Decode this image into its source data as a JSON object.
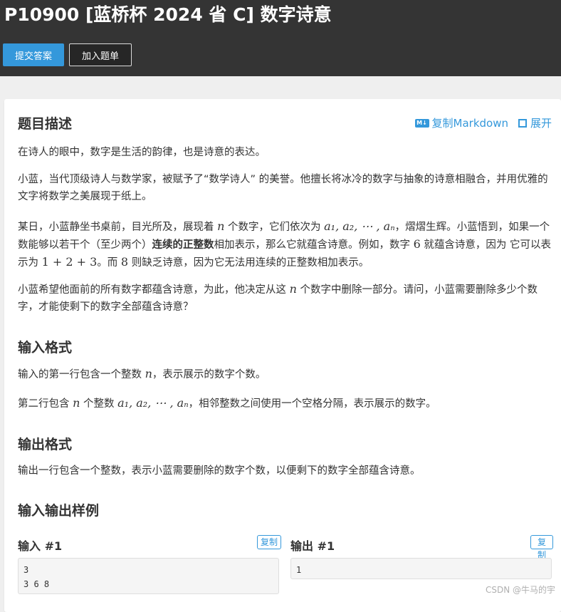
{
  "header": {
    "title": "P10900 [蓝桥杯 2024 省 C] 数字诗意",
    "submit_label": "提交答案",
    "add_list_label": "加入题单"
  },
  "tools": {
    "copy_markdown": "复制Markdown",
    "expand": "展开",
    "md_icon_text": "M↓"
  },
  "description": {
    "heading": "题目描述",
    "p1": "在诗人的眼中，数字是生活的韵律，也是诗意的表达。",
    "p2": "小蓝，当代顶级诗人与数学家，被赋予了“数学诗人” 的美誉。他擅长将冰冷的数字与抽象的诗意相融合，并用优雅的文字将数学之美展现于纸上。",
    "p3": {
      "t1": "某日，小蓝静坐书桌前，目光所及，展现着 ",
      "n": "n",
      "t2": " 个数字，它们依次为 ",
      "seq": "a₁, a₂, ⋯ , aₙ",
      "t3": "，熠熠生辉。小蓝悟到，如果一个数能够以若干个（至少两个）",
      "bold": "连续的正整数",
      "t4": "相加表示，那么它就蕴含诗意。例如，数字 ",
      "six": "6",
      "t5": " 就蕴含诗意，因为 它可以表示为 ",
      "expr": "1 + 2 + 3",
      "t6": "。而 ",
      "eight": "8",
      "t7": " 则缺乏诗意，因为它无法用连续的正整数相加表示。"
    },
    "p4": {
      "t1": "小蓝希望他面前的所有数字都蕴含诗意，为此，他决定从这 ",
      "n": "n",
      "t2": " 个数字中删除一部分。请问，小蓝需要删除多少个数字，才能使剩下的数字全部蕴含诗意？"
    }
  },
  "input_format": {
    "heading": "输入格式",
    "p1": {
      "t1": "输入的第一行包含一个整数 ",
      "n": "n",
      "t2": "，表示展示的数字个数。"
    },
    "p2": {
      "t1": "第二行包含 ",
      "n": "n",
      "t2": " 个整数 ",
      "seq": "a₁, a₂, ⋯ , aₙ",
      "t3": "，相邻整数之间使用一个空格分隔，表示展示的数字。"
    }
  },
  "output_format": {
    "heading": "输出格式",
    "p1": "输出一行包含一个整数，表示小蓝需要删除的数字个数，以便剩下的数字全部蕴含诗意。"
  },
  "samples": {
    "heading": "输入输出样例",
    "input_label": "输入 #1",
    "output_label": "输出 #1",
    "copy_label": "复制",
    "input_value": "3\n3 6 8",
    "output_value": "1"
  },
  "watermark": "CSDN @牛马的宇",
  "colors": {
    "header_bg": "#343434",
    "accent": "#3498db",
    "page_bg": "#efefef"
  }
}
